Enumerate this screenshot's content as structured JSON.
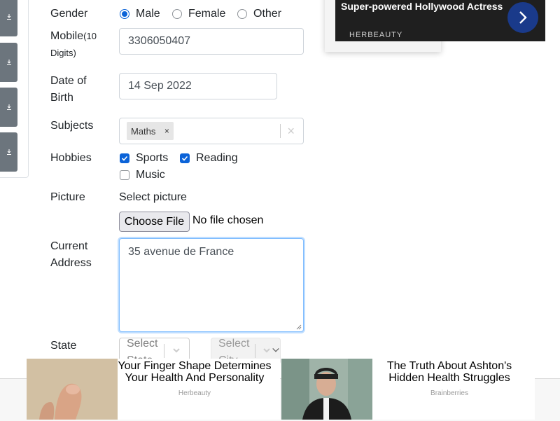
{
  "form": {
    "gender": {
      "label": "Gender",
      "options": [
        {
          "label": "Male",
          "checked": true
        },
        {
          "label": "Female",
          "checked": false
        },
        {
          "label": "Other",
          "checked": false
        }
      ]
    },
    "mobile": {
      "label": "Mobile",
      "hint_line1": "(10",
      "hint_line2": "Digits)",
      "value": "3306050407"
    },
    "dob": {
      "label_line1": "Date of",
      "label_line2": "Birth",
      "value": "14 Sep 2022"
    },
    "subjects": {
      "label": "Subjects",
      "chips": [
        "Maths"
      ],
      "clear": "×",
      "chip_remove": "×"
    },
    "hobbies": {
      "label": "Hobbies",
      "options": [
        {
          "label": "Sports",
          "checked": true
        },
        {
          "label": "Reading",
          "checked": true
        },
        {
          "label": "Music",
          "checked": false
        }
      ]
    },
    "picture": {
      "label": "Picture",
      "caption": "Select picture",
      "button": "Choose File",
      "status": "No file chosen"
    },
    "address": {
      "label_line1": "Current",
      "label_line2": "Address",
      "value": "35 avenue de France"
    },
    "state": {
      "label": "State",
      "placeholder_state": "Select State",
      "placeholder_city": "Select City"
    }
  },
  "ads": {
    "top": {
      "title": "It Has Made Morena Baccarin A Super-powered Hollywood Actress",
      "source": "HERBEAUTY"
    },
    "bottom": [
      {
        "title": "Your Finger Shape Determines Your Health And Personality",
        "source": "Herbeauty"
      },
      {
        "title": "The Truth About Ashton's Hidden Health Struggles",
        "source": "Brainberries"
      }
    ]
  },
  "colors": {
    "accent": "#0b63d8",
    "focus_border": "#80bdff",
    "sidebar_button": "#6c757d"
  }
}
